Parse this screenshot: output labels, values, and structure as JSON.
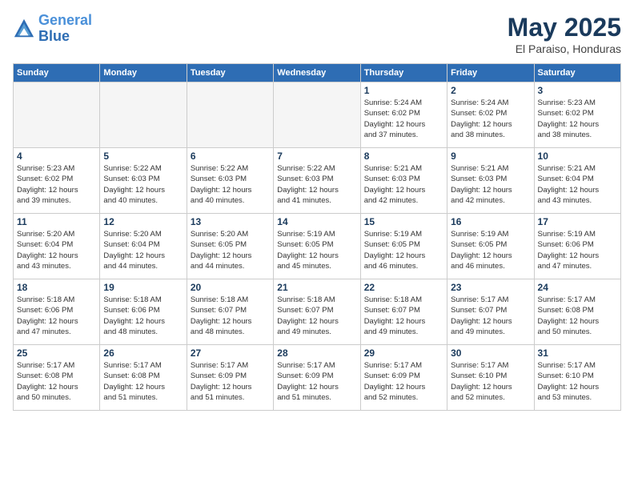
{
  "logo": {
    "line1": "General",
    "line2": "Blue"
  },
  "calendar": {
    "title": "May 2025",
    "subtitle": "El Paraiso, Honduras"
  },
  "headers": [
    "Sunday",
    "Monday",
    "Tuesday",
    "Wednesday",
    "Thursday",
    "Friday",
    "Saturday"
  ],
  "weeks": [
    [
      {
        "day": "",
        "info": "",
        "empty": true
      },
      {
        "day": "",
        "info": "",
        "empty": true
      },
      {
        "day": "",
        "info": "",
        "empty": true
      },
      {
        "day": "",
        "info": "",
        "empty": true
      },
      {
        "day": "1",
        "info": "Sunrise: 5:24 AM\nSunset: 6:02 PM\nDaylight: 12 hours\nand 37 minutes.",
        "empty": false
      },
      {
        "day": "2",
        "info": "Sunrise: 5:24 AM\nSunset: 6:02 PM\nDaylight: 12 hours\nand 38 minutes.",
        "empty": false
      },
      {
        "day": "3",
        "info": "Sunrise: 5:23 AM\nSunset: 6:02 PM\nDaylight: 12 hours\nand 38 minutes.",
        "empty": false
      }
    ],
    [
      {
        "day": "4",
        "info": "Sunrise: 5:23 AM\nSunset: 6:02 PM\nDaylight: 12 hours\nand 39 minutes.",
        "empty": false
      },
      {
        "day": "5",
        "info": "Sunrise: 5:22 AM\nSunset: 6:03 PM\nDaylight: 12 hours\nand 40 minutes.",
        "empty": false
      },
      {
        "day": "6",
        "info": "Sunrise: 5:22 AM\nSunset: 6:03 PM\nDaylight: 12 hours\nand 40 minutes.",
        "empty": false
      },
      {
        "day": "7",
        "info": "Sunrise: 5:22 AM\nSunset: 6:03 PM\nDaylight: 12 hours\nand 41 minutes.",
        "empty": false
      },
      {
        "day": "8",
        "info": "Sunrise: 5:21 AM\nSunset: 6:03 PM\nDaylight: 12 hours\nand 42 minutes.",
        "empty": false
      },
      {
        "day": "9",
        "info": "Sunrise: 5:21 AM\nSunset: 6:03 PM\nDaylight: 12 hours\nand 42 minutes.",
        "empty": false
      },
      {
        "day": "10",
        "info": "Sunrise: 5:21 AM\nSunset: 6:04 PM\nDaylight: 12 hours\nand 43 minutes.",
        "empty": false
      }
    ],
    [
      {
        "day": "11",
        "info": "Sunrise: 5:20 AM\nSunset: 6:04 PM\nDaylight: 12 hours\nand 43 minutes.",
        "empty": false
      },
      {
        "day": "12",
        "info": "Sunrise: 5:20 AM\nSunset: 6:04 PM\nDaylight: 12 hours\nand 44 minutes.",
        "empty": false
      },
      {
        "day": "13",
        "info": "Sunrise: 5:20 AM\nSunset: 6:05 PM\nDaylight: 12 hours\nand 44 minutes.",
        "empty": false
      },
      {
        "day": "14",
        "info": "Sunrise: 5:19 AM\nSunset: 6:05 PM\nDaylight: 12 hours\nand 45 minutes.",
        "empty": false
      },
      {
        "day": "15",
        "info": "Sunrise: 5:19 AM\nSunset: 6:05 PM\nDaylight: 12 hours\nand 46 minutes.",
        "empty": false
      },
      {
        "day": "16",
        "info": "Sunrise: 5:19 AM\nSunset: 6:05 PM\nDaylight: 12 hours\nand 46 minutes.",
        "empty": false
      },
      {
        "day": "17",
        "info": "Sunrise: 5:19 AM\nSunset: 6:06 PM\nDaylight: 12 hours\nand 47 minutes.",
        "empty": false
      }
    ],
    [
      {
        "day": "18",
        "info": "Sunrise: 5:18 AM\nSunset: 6:06 PM\nDaylight: 12 hours\nand 47 minutes.",
        "empty": false
      },
      {
        "day": "19",
        "info": "Sunrise: 5:18 AM\nSunset: 6:06 PM\nDaylight: 12 hours\nand 48 minutes.",
        "empty": false
      },
      {
        "day": "20",
        "info": "Sunrise: 5:18 AM\nSunset: 6:07 PM\nDaylight: 12 hours\nand 48 minutes.",
        "empty": false
      },
      {
        "day": "21",
        "info": "Sunrise: 5:18 AM\nSunset: 6:07 PM\nDaylight: 12 hours\nand 49 minutes.",
        "empty": false
      },
      {
        "day": "22",
        "info": "Sunrise: 5:18 AM\nSunset: 6:07 PM\nDaylight: 12 hours\nand 49 minutes.",
        "empty": false
      },
      {
        "day": "23",
        "info": "Sunrise: 5:17 AM\nSunset: 6:07 PM\nDaylight: 12 hours\nand 49 minutes.",
        "empty": false
      },
      {
        "day": "24",
        "info": "Sunrise: 5:17 AM\nSunset: 6:08 PM\nDaylight: 12 hours\nand 50 minutes.",
        "empty": false
      }
    ],
    [
      {
        "day": "25",
        "info": "Sunrise: 5:17 AM\nSunset: 6:08 PM\nDaylight: 12 hours\nand 50 minutes.",
        "empty": false
      },
      {
        "day": "26",
        "info": "Sunrise: 5:17 AM\nSunset: 6:08 PM\nDaylight: 12 hours\nand 51 minutes.",
        "empty": false
      },
      {
        "day": "27",
        "info": "Sunrise: 5:17 AM\nSunset: 6:09 PM\nDaylight: 12 hours\nand 51 minutes.",
        "empty": false
      },
      {
        "day": "28",
        "info": "Sunrise: 5:17 AM\nSunset: 6:09 PM\nDaylight: 12 hours\nand 51 minutes.",
        "empty": false
      },
      {
        "day": "29",
        "info": "Sunrise: 5:17 AM\nSunset: 6:09 PM\nDaylight: 12 hours\nand 52 minutes.",
        "empty": false
      },
      {
        "day": "30",
        "info": "Sunrise: 5:17 AM\nSunset: 6:10 PM\nDaylight: 12 hours\nand 52 minutes.",
        "empty": false
      },
      {
        "day": "31",
        "info": "Sunrise: 5:17 AM\nSunset: 6:10 PM\nDaylight: 12 hours\nand 53 minutes.",
        "empty": false
      }
    ]
  ]
}
